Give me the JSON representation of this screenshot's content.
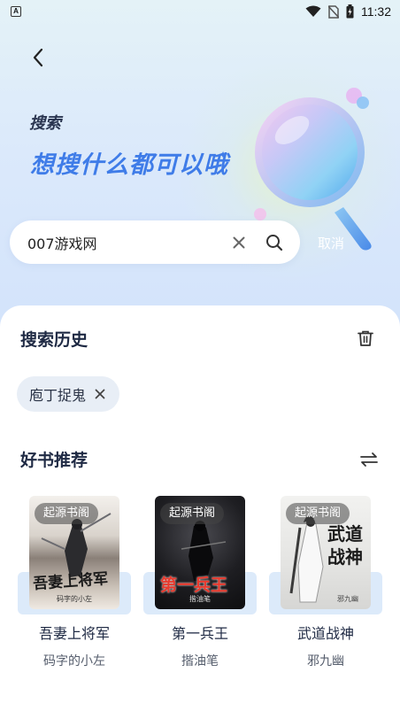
{
  "status_bar": {
    "app_icon_letter": "A",
    "time": "11:32"
  },
  "hero": {
    "label": "搜索",
    "slogan": "想搜什么都可以哦",
    "sparkle": "✦"
  },
  "search": {
    "value": "007游戏网",
    "cancel_label": "取消"
  },
  "history": {
    "title": "搜索历史",
    "items": [
      {
        "label": "庖丁捉鬼"
      }
    ]
  },
  "recommend": {
    "title": "好书推荐",
    "books": [
      {
        "badge": "起源书阁",
        "cover_title": "吾妻上将军",
        "cover_author": "码字的小左",
        "title": "吾妻上将军",
        "author": "码字的小左"
      },
      {
        "badge": "起源书阁",
        "cover_title": "第一兵王",
        "cover_author": "揩油笔",
        "title": "第一兵王",
        "author": "揩油笔"
      },
      {
        "badge": "起源书阁",
        "cover_title": "武道战神",
        "cover_author": "邪九幽",
        "title": "武道战神",
        "author": "邪九幽"
      }
    ]
  },
  "colors": {
    "accent": "#3f7ce8",
    "chip_bg": "#e8eef6",
    "title_text": "#1f2a44"
  }
}
